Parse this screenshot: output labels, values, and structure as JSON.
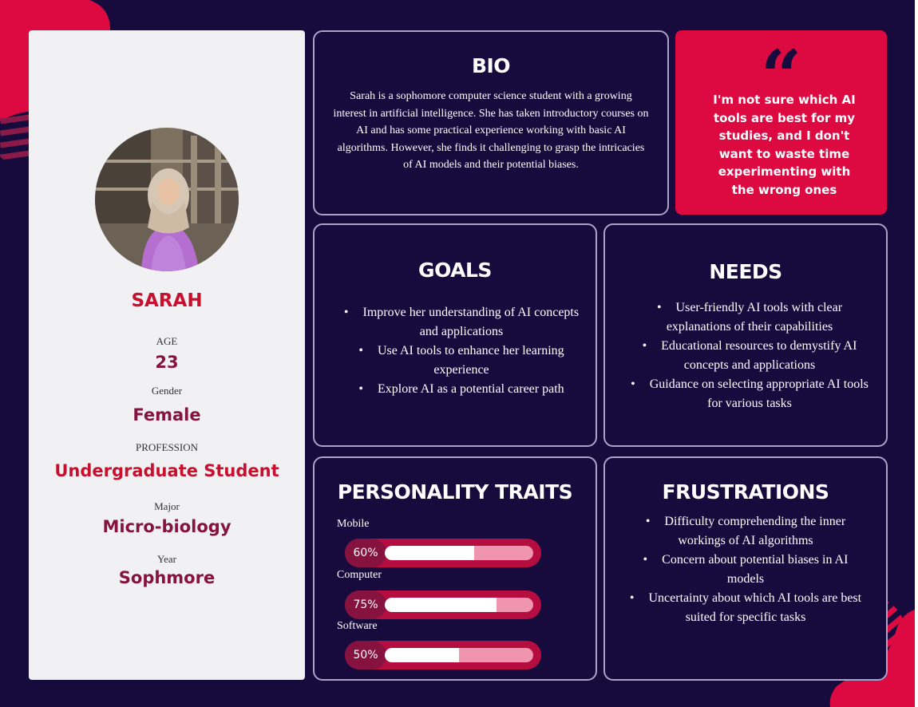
{
  "profile": {
    "name": "SARAH",
    "age_label": "AGE",
    "age": "23",
    "gender_label": "Gender",
    "gender": "Female",
    "profession_label": "PROFESSION",
    "profession": "Undergraduate Student",
    "major_label": "Major",
    "major": "Micro-biology",
    "year_label": "Year",
    "year": "Sophmore"
  },
  "bio": {
    "title": "BIO",
    "text": "Sarah is a sophomore computer science student with a growing interest in artificial intelligence. She has taken introductory courses on AI and has some practical experience working with basic AI algorithms. However, she finds it challenging to grasp the intricacies of AI models and their potential biases."
  },
  "quote": {
    "mark": "“",
    "text": "I'm not sure which AI tools are best for my studies, and I don't want to waste time experimenting with the wrong ones"
  },
  "goals": {
    "title": "GOALS",
    "items": [
      "Improve her understanding of AI concepts and applications",
      "Use AI tools to enhance her learning experience",
      "Explore AI as a potential career path"
    ]
  },
  "needs": {
    "title": "NEEDS",
    "items": [
      "User-friendly AI tools with clear explanations of their capabilities",
      "Educational resources to demystify AI concepts and applications",
      "Guidance on selecting appropriate AI tools for various tasks"
    ]
  },
  "traits": {
    "title": "PERSONALITY TRAITS",
    "items": [
      {
        "label": "Mobile",
        "percent_text": "60%",
        "value": 0.6
      },
      {
        "label": "Computer",
        "percent_text": "75%",
        "value": 0.75
      },
      {
        "label": "Software",
        "percent_text": "50%",
        "value": 0.5
      }
    ]
  },
  "frustrations": {
    "title": "FRUSTRATIONS",
    "items": [
      "Difficulty comprehending the inner workings of AI algorithms",
      "Concern about potential biases in AI models",
      "Uncertainty about which AI tools are best suited for specific tasks"
    ]
  },
  "colors": {
    "background": "#170a3d",
    "accent": "#dc0a41",
    "name_red": "#c8102e",
    "value_maroon": "#85123f",
    "card_border": "#aaa3c9"
  }
}
